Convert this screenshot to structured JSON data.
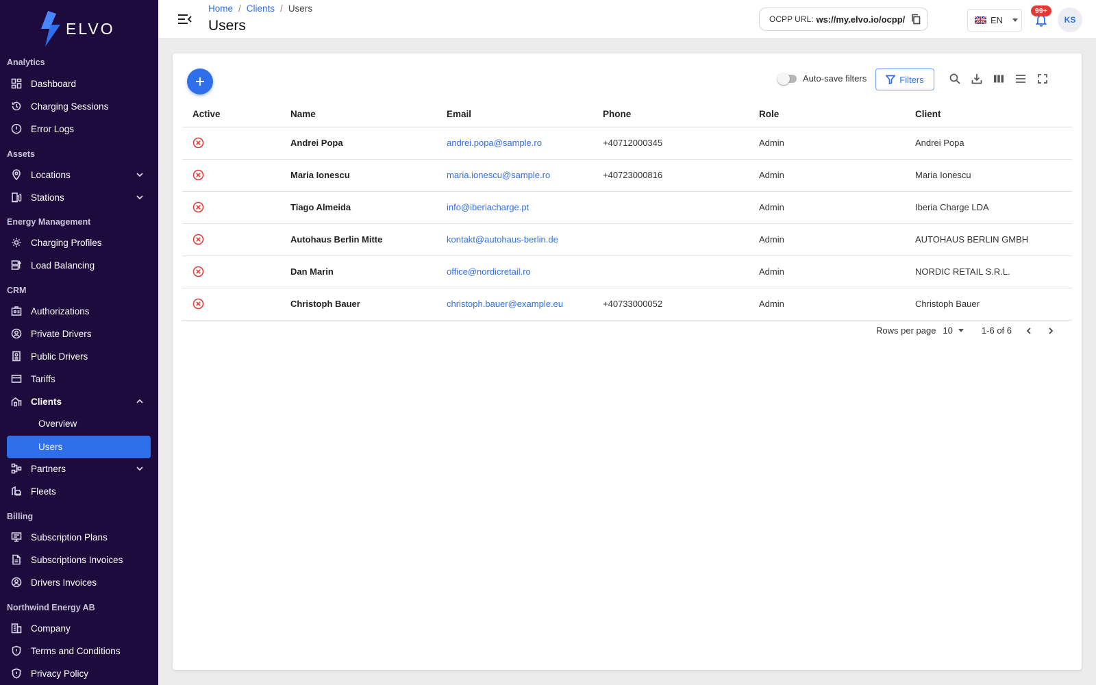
{
  "brand": {
    "name": "ELVO"
  },
  "sidebar": {
    "sections": {
      "analytics": "Analytics",
      "assets": "Assets",
      "energy": "Energy Management",
      "crm": "CRM",
      "billing": "Billing",
      "company": "Northwind Energy AB"
    },
    "items": {
      "dashboard": "Dashboard",
      "charging_sessions": "Charging Sessions",
      "error_logs": "Error Logs",
      "locations": "Locations",
      "stations": "Stations",
      "charging_profiles": "Charging Profiles",
      "load_balancing": "Load Balancing",
      "authorizations": "Authorizations",
      "private_drivers": "Private Drivers",
      "public_drivers": "Public Drivers",
      "tariffs": "Tariffs",
      "clients": "Clients",
      "clients_overview": "Overview",
      "clients_users": "Users",
      "partners": "Partners",
      "fleets": "Fleets",
      "subscription_plans": "Subscription Plans",
      "subscriptions_invoices": "Subscriptions Invoices",
      "drivers_invoices": "Drivers Invoices",
      "company": "Company",
      "terms": "Terms and Conditions",
      "privacy": "Privacy Policy"
    }
  },
  "header": {
    "breadcrumb": [
      "Home",
      "Clients",
      "Users"
    ],
    "title": "Users",
    "ocpp_label": "OCPP URL:",
    "ocpp_value": "ws://my.elvo.io/ocpp/",
    "language": "EN",
    "notifications": "99+",
    "avatar_initials": "KS"
  },
  "toolbar": {
    "autosave_label": "Auto-save filters",
    "filters_label": "Filters"
  },
  "table": {
    "columns": [
      "Active",
      "Name",
      "Email",
      "Phone",
      "Role",
      "Client"
    ],
    "rows": [
      {
        "name": "Andrei Popa",
        "email": "andrei.popa@sample.ro",
        "phone": "+40712000345",
        "role": "Admin",
        "client": "Andrei Popa"
      },
      {
        "name": "Maria Ionescu",
        "email": "maria.ionescu@sample.ro",
        "phone": "+40723000816",
        "role": "Admin",
        "client": "Maria Ionescu"
      },
      {
        "name": "Tiago Almeida",
        "email": "info@iberiacharge.pt",
        "phone": "",
        "role": "Admin",
        "client": "Iberia Charge LDA"
      },
      {
        "name": "Autohaus Berlin Mitte",
        "email": "kontakt@autohaus-berlin.de",
        "phone": "",
        "role": "Admin",
        "client": "AUTOHAUS BERLIN GMBH"
      },
      {
        "name": "Dan Marin",
        "email": "office@nordicretail.ro",
        "phone": "",
        "role": "Admin",
        "client": "NORDIC RETAIL S.R.L."
      },
      {
        "name": "Christoph Bauer",
        "email": "christoph.bauer@example.eu",
        "phone": "+40733000052",
        "role": "Admin",
        "client": "Christoph Bauer"
      }
    ]
  },
  "pagination": {
    "rows_per_page_label": "Rows per page",
    "rows_per_page": "10",
    "range": "1-6 of 6"
  },
  "colors": {
    "sidebar_bg": "#1c0b3c",
    "accent": "#2f6fe9",
    "inactive": "#e53935"
  }
}
